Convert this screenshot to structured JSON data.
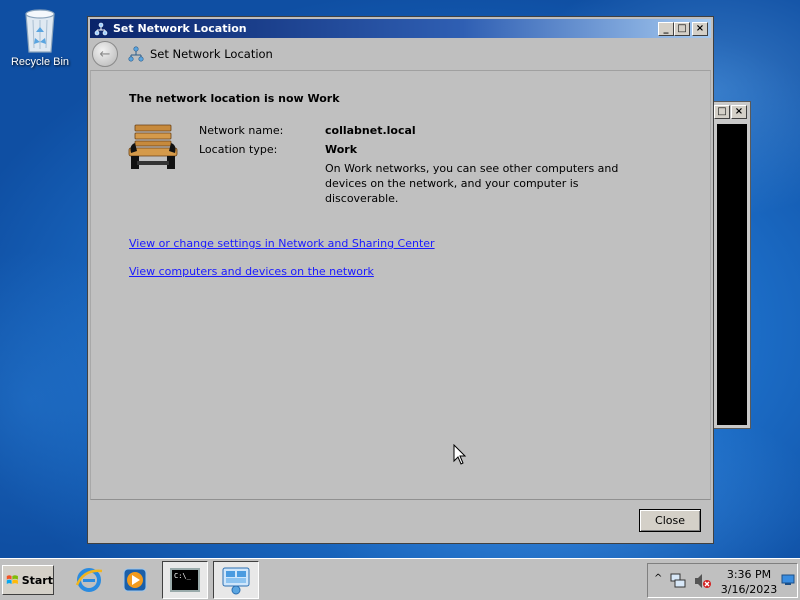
{
  "desktop": {
    "recycle_bin_label": "Recycle Bin"
  },
  "window": {
    "title": "Set Network Location",
    "nav_title": "Set Network Location",
    "heading": "The network location is now Work",
    "network_name_label": "Network name:",
    "network_name_value": "collabnet.local",
    "location_type_label": "Location type:",
    "location_type_value": "Work",
    "location_description": "On Work networks, you can see other computers and devices on the network, and your computer is discoverable.",
    "link_network_sharing": "View or change settings in Network and Sharing Center",
    "link_view_computers": "View computers and devices on the network",
    "close_label": "Close",
    "minimize_glyph": "_",
    "maximize_glyph": "□",
    "close_glyph": "×"
  },
  "taskbar": {
    "start_label": "Start",
    "items": [
      "internet-explorer-icon",
      "windows-media-player-icon",
      "command-prompt-icon",
      "network-center-icon"
    ],
    "console_glyph": "C:\\_",
    "tray_arrow": "^",
    "time": "3:36 PM",
    "date": "3/16/2023"
  },
  "colors": {
    "title_bar": "#0a246a",
    "link": "#1a1aff",
    "desktop": "#1f74cf"
  }
}
